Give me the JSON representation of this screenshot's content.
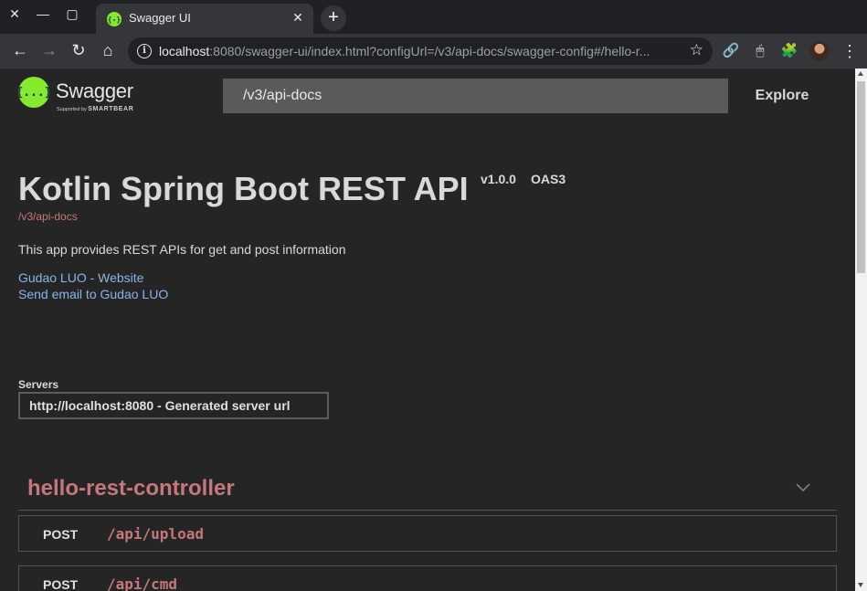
{
  "browser": {
    "tab_title": "Swagger UI",
    "favicon_glyph": "{-}",
    "new_tab": "+",
    "url_host": "localhost",
    "url_rest": ":8080/swagger-ui/index.html?configUrl=/v3/api-docs/swagger-config#/hello-r...",
    "controls": {
      "close": "✕",
      "minimize": "—",
      "maximize": "▢"
    },
    "nav": {
      "back": "←",
      "forward": "→",
      "reload": "↻",
      "home": "⌂"
    },
    "star": "☆",
    "extensions": {
      "link": "🔗",
      "mouse": "🖱",
      "puzzle": "🧩",
      "menu": "⋮"
    }
  },
  "swagger": {
    "logo_mark": "{...}",
    "logo_name": "Swagger",
    "logo_sub_prefix": "Supported by ",
    "logo_sub_brand": "SMARTBEAR",
    "search_value": "/v3/api-docs",
    "explore_label": "Explore"
  },
  "info": {
    "title": "Kotlin Spring Boot REST API",
    "version": "v1.0.0",
    "oas": "OAS3",
    "spec_url": "/v3/api-docs",
    "description": "This app provides REST APIs for get and post information",
    "links": [
      "Gudao LUO - Website",
      "Send email to Gudao LUO"
    ]
  },
  "servers": {
    "label": "Servers",
    "selected": "http://localhost:8080 - Generated server url"
  },
  "tag": {
    "name": "hello-rest-controller",
    "operations": [
      {
        "method": "POST",
        "path": "/api/upload"
      },
      {
        "method": "POST",
        "path": "/api/cmd"
      }
    ]
  },
  "colors": {
    "background": "#252525",
    "accent": "#c5787b",
    "link": "#8ab4e8",
    "swagger_green": "#85ea2d"
  }
}
